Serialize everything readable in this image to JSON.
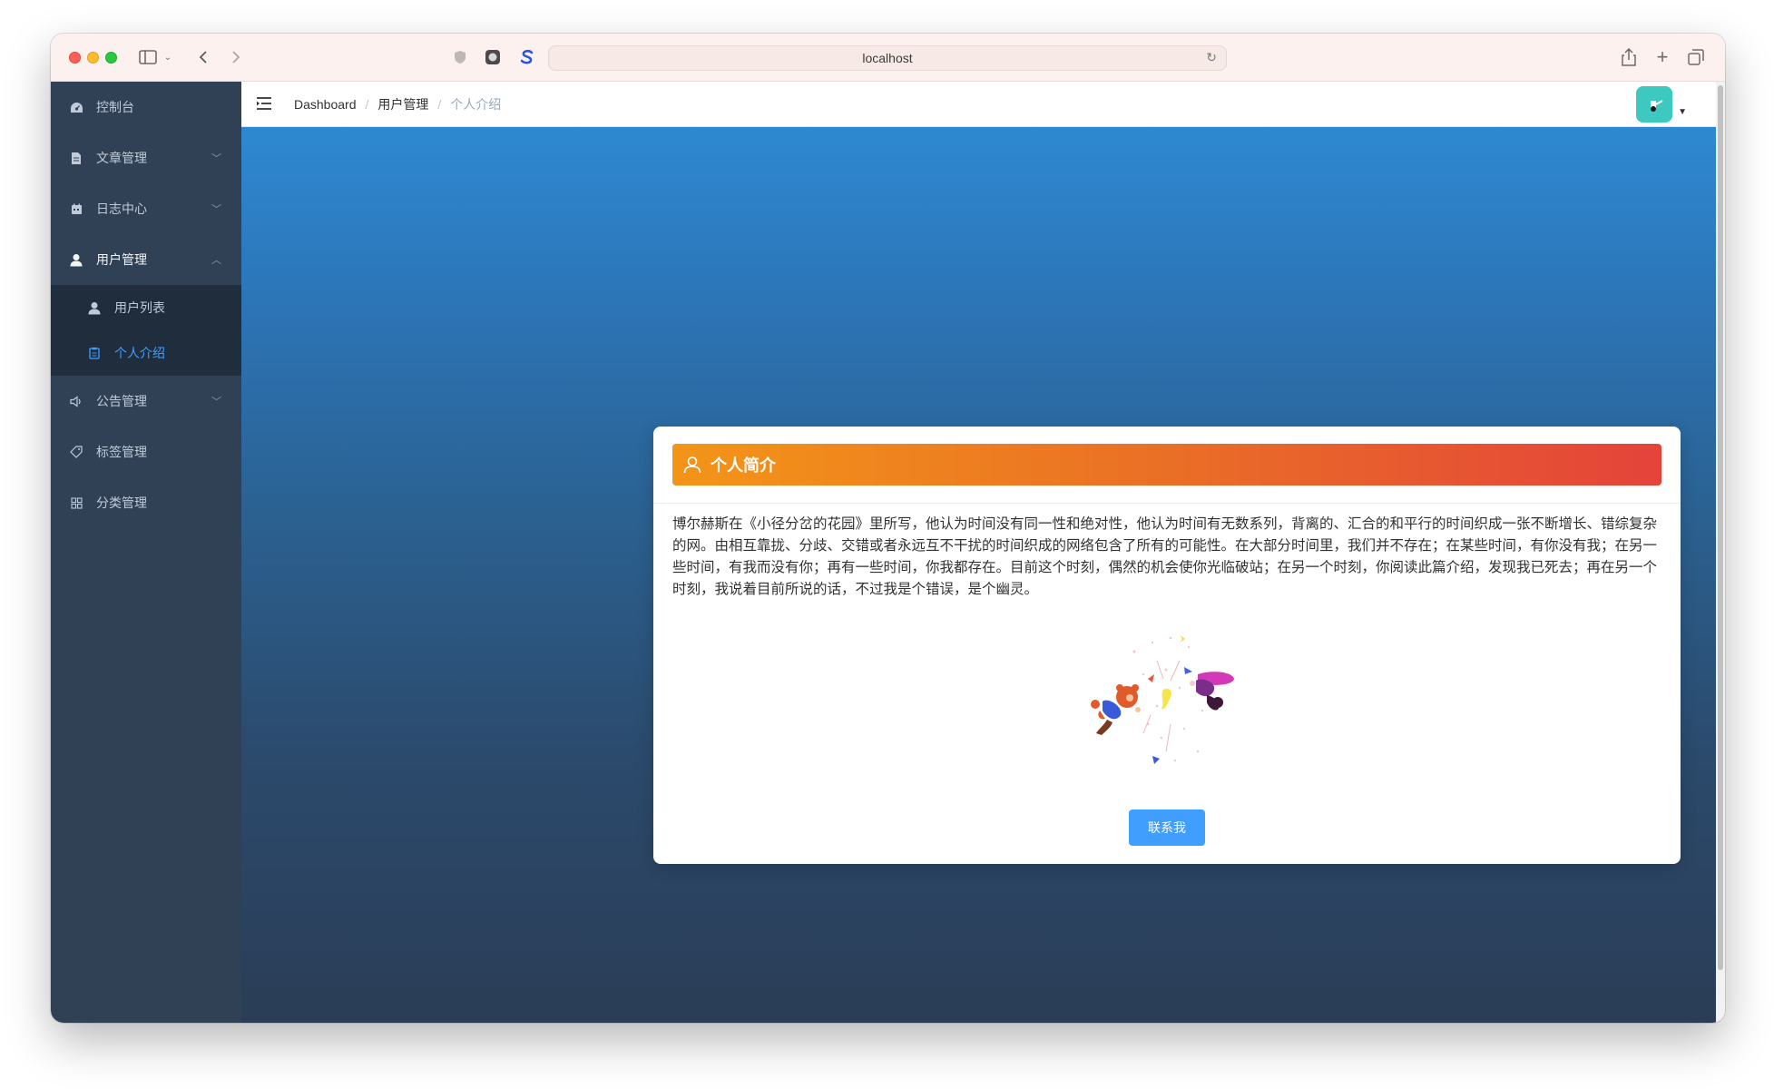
{
  "browser": {
    "url": "localhost"
  },
  "sidebar": {
    "items": [
      {
        "label": "控制台",
        "icon": "dashboard-icon",
        "has_chevron": false
      },
      {
        "label": "文章管理",
        "icon": "document-icon",
        "has_chevron": true,
        "expanded": false
      },
      {
        "label": "日志中心",
        "icon": "calendar-icon",
        "has_chevron": true,
        "expanded": false
      },
      {
        "label": "用户管理",
        "icon": "user-icon",
        "has_chevron": true,
        "expanded": true,
        "children": [
          {
            "label": "用户列表",
            "icon": "user-icon",
            "active": false
          },
          {
            "label": "个人介绍",
            "icon": "clipboard-icon",
            "active": true
          }
        ]
      },
      {
        "label": "公告管理",
        "icon": "speaker-icon",
        "has_chevron": true,
        "expanded": false
      },
      {
        "label": "标签管理",
        "icon": "tag-icon",
        "has_chevron": false
      },
      {
        "label": "分类管理",
        "icon": "grid-icon",
        "has_chevron": false
      }
    ]
  },
  "navbar": {
    "breadcrumb": [
      "Dashboard",
      "用户管理",
      "个人介绍"
    ]
  },
  "card": {
    "title": "个人简介",
    "body": "博尔赫斯在《小径分岔的花园》里所写，他认为时间没有同一性和绝对性，他认为时间有无数系列，背离的、汇合的和平行的时间织成一张不断增长、错综复杂的网。由相互靠拢、分歧、交错或者永远互不干扰的时间织成的网络包含了所有的可能性。在大部分时间里，我们并不存在；在某些时间，有你没有我；在另一些时间，有我而没有你；再有一些时间，你我都存在。目前这个时刻，偶然的机会使你光临破站；在另一个时刻，你阅读此篇介绍，发现我已死去；再在另一个时刻，我说着目前所说的话，不过我是个错误，是个幽灵。",
    "button_label": "联系我"
  },
  "colors": {
    "sidebar_bg": "#304156",
    "submenu_bg": "#1f2d3d",
    "active": "#409eff",
    "header_gradient_start": "#f39518",
    "header_gradient_end": "#e4433a"
  }
}
